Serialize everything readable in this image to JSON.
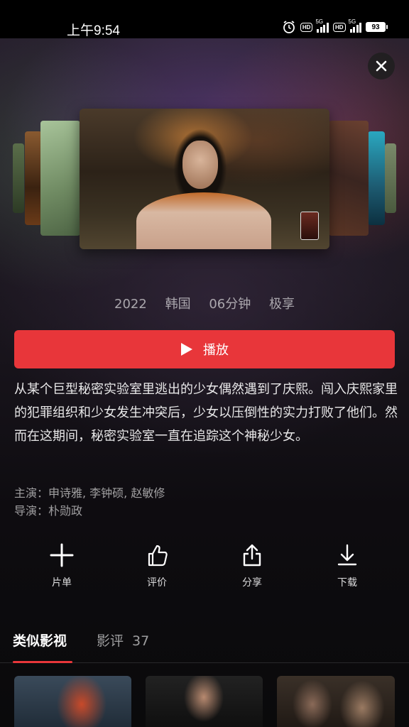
{
  "status_bar": {
    "time": "上午9:54",
    "hd1": "HD",
    "net1": "5G",
    "hd2": "HD",
    "net2": "5G",
    "battery": "93"
  },
  "movie": {
    "year": "2022",
    "country": "韩国",
    "duration": "06分钟",
    "platform": "极享",
    "play_label": "播放",
    "description": "从某个巨型秘密实验室里逃出的少女偶然遇到了庆熙。闯入庆熙家里的犯罪组织和少女发生冲突后，少女以压倒性的实力打败了他们。然而在这期间，秘密实验室一直在追踪这个神秘少女。",
    "cast_line": "主演：申诗雅, 李钟硕, 赵敏修",
    "director_line": "导演：朴勋政"
  },
  "actions": [
    {
      "label": "片单",
      "icon": "plus-icon"
    },
    {
      "label": "评价",
      "icon": "thumbs-up-icon"
    },
    {
      "label": "分享",
      "icon": "share-icon"
    },
    {
      "label": "下载",
      "icon": "download-icon"
    }
  ],
  "tabs": {
    "similar": "类似影视",
    "reviews": "影评",
    "reviews_count": "37"
  },
  "colors": {
    "accent": "#e8363a"
  }
}
